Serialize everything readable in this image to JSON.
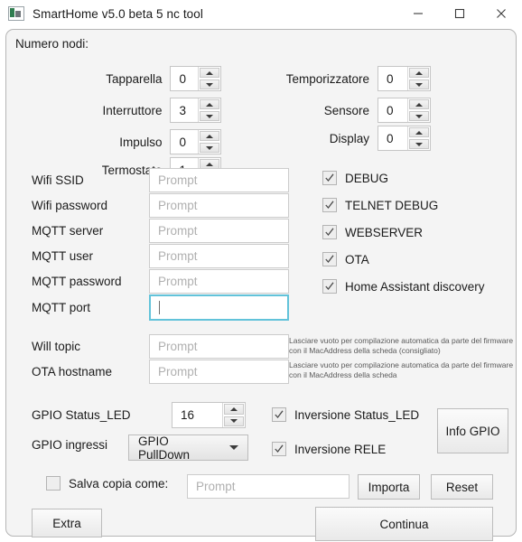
{
  "window": {
    "title": "SmartHome v5.0 beta 5 nc tool",
    "icon": "app-icon",
    "minimize": "minimize-icon",
    "maximize": "maximize-icon",
    "close": "close-icon"
  },
  "group": {
    "title": "Numero nodi:"
  },
  "nodes_left": [
    {
      "label": "Tapparella",
      "value": "0"
    },
    {
      "label": "Interruttore",
      "value": "3"
    },
    {
      "label": "Impulso",
      "value": "0"
    },
    {
      "label": "Termostato",
      "value": "1"
    }
  ],
  "nodes_right": [
    {
      "label": "Temporizzatore",
      "value": "0"
    },
    {
      "label": "Sensore",
      "value": "0"
    },
    {
      "label": "Display",
      "value": "0"
    }
  ],
  "fields": [
    {
      "label": "Wifi SSID",
      "value": "",
      "placeholder": "Prompt",
      "focused": false
    },
    {
      "label": "Wifi password",
      "value": "",
      "placeholder": "Prompt",
      "focused": false
    },
    {
      "label": "MQTT server",
      "value": "",
      "placeholder": "Prompt",
      "focused": false
    },
    {
      "label": "MQTT user",
      "value": "",
      "placeholder": "Prompt",
      "focused": false
    },
    {
      "label": "MQTT password",
      "value": "",
      "placeholder": "Prompt",
      "focused": false
    },
    {
      "label": "MQTT port",
      "value": "",
      "placeholder": "",
      "focused": true
    }
  ],
  "fields2": [
    {
      "label": "Will topic",
      "value": "",
      "placeholder": "Prompt",
      "hint": "Lasciare vuoto per compilazione automatica da parte del firmware con il MacAddress della scheda (consigliato)"
    },
    {
      "label": "OTA hostname",
      "value": "",
      "placeholder": "Prompt",
      "hint": "Lasciare vuoto per compilazione automatica da parte del firmware con il MacAddress della scheda"
    }
  ],
  "options": [
    {
      "label": "DEBUG",
      "checked": true
    },
    {
      "label": "TELNET DEBUG",
      "checked": true
    },
    {
      "label": "WEBSERVER",
      "checked": true
    },
    {
      "label": "OTA",
      "checked": true
    },
    {
      "label": "Home Assistant discovery",
      "checked": true
    }
  ],
  "gpio": {
    "status_led_label": "GPIO Status_LED",
    "status_led_value": "16",
    "ingressi_label": "GPIO ingressi",
    "ingressi_value": "GPIO PullDown",
    "inversione_led": {
      "label": "Inversione Status_LED",
      "checked": true
    },
    "inversione_rele": {
      "label": "Inversione RELE",
      "checked": true
    },
    "info_button": "Info GPIO"
  },
  "bottom": {
    "save_copy_label": "Salva copia come:",
    "save_copy_checked": false,
    "save_copy_placeholder": "Prompt",
    "save_copy_value": "",
    "importa": "Importa",
    "reset": "Reset",
    "extra": "Extra",
    "continua": "Continua"
  },
  "colors": {
    "focus_border": "#62c3da",
    "panel_bg": "#f4f4f4",
    "panel_border": "#b5b5b5",
    "text": "#1b1b1b",
    "placeholder": "#b0b0b0"
  }
}
